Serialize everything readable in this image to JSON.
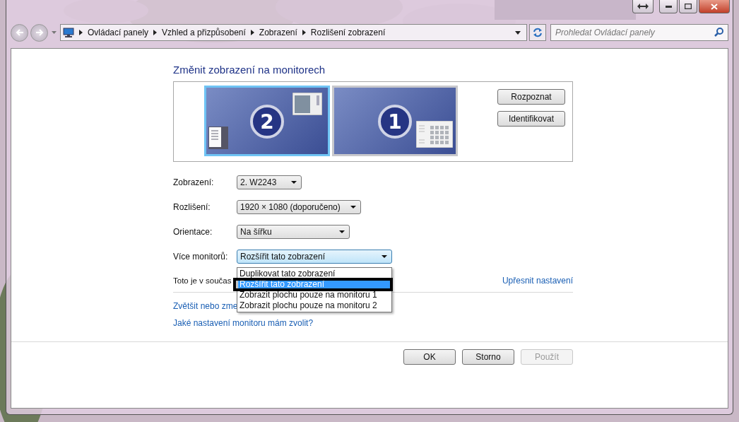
{
  "navigation": {
    "breadcrumbs": [
      "Ovládací panely",
      "Vzhled a přizpůsobení",
      "Zobrazení",
      "Rozlišení zobrazení"
    ],
    "search": {
      "placeholder": "Prohledat Ovládací panely"
    }
  },
  "heading": "Změnit zobrazení na monitorech",
  "monitors": [
    {
      "number": "2",
      "selected": true
    },
    {
      "number": "1",
      "selected": false
    }
  ],
  "monitor_buttons": [
    "Rozpoznat",
    "Identifikovat"
  ],
  "settings": [
    {
      "label": "Zobrazení:",
      "value": "2. W2243",
      "open": false
    },
    {
      "label": "Rozlišení:",
      "value": "1920 × 1080 (doporučeno)",
      "open": false
    },
    {
      "label": "Orientace:",
      "value": "Na šířku",
      "open": false
    },
    {
      "label": "Více monitorů:",
      "value": "Rozšířit tato zobrazení",
      "open": true
    }
  ],
  "dropdown_options": [
    {
      "label": "Duplikovat tato zobrazení",
      "selected": false
    },
    {
      "label": "Rozšířit tato zobrazení",
      "selected": true
    },
    {
      "label": "Zobrazit plochu pouze na monitoru 1",
      "selected": false
    },
    {
      "label": "Zobrazit plochu pouze na monitoru 2",
      "selected": false
    }
  ],
  "status_text": "Toto je v součas",
  "advanced_link": "Upřesnit nastavení",
  "links": [
    "Zvětšit nebo zme",
    "Jaké nastavení monitoru mám zvolit?"
  ],
  "buttons": [
    {
      "label": "OK",
      "disabled": false
    },
    {
      "label": "Storno",
      "disabled": false
    },
    {
      "label": "Použít",
      "disabled": true
    }
  ]
}
